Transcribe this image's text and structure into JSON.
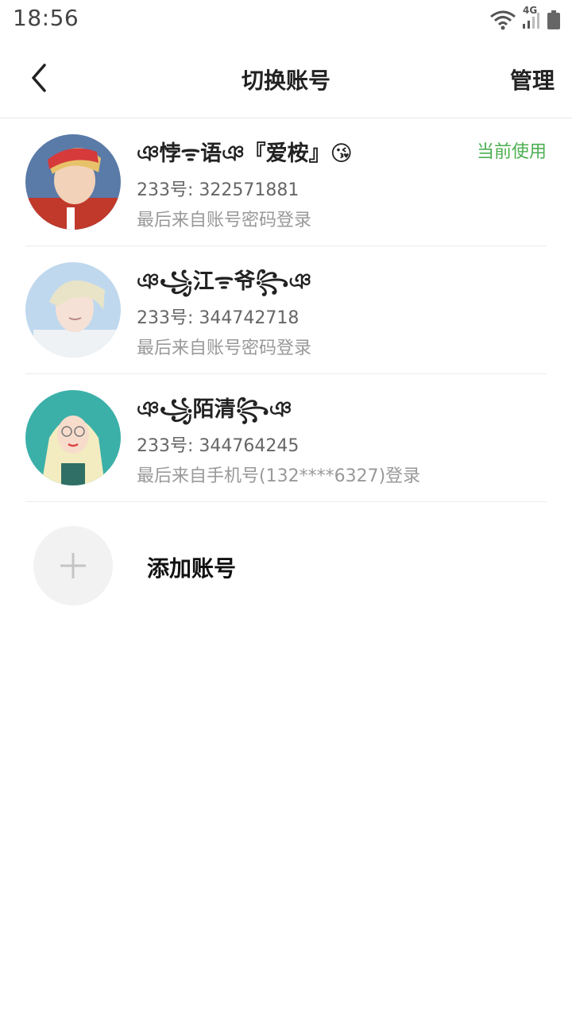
{
  "status_bar": {
    "time": "18:56",
    "network": "4G"
  },
  "header": {
    "title": "切换账号",
    "manage_label": "管理"
  },
  "accounts": [
    {
      "name": "ঞ悖ᯤ语ঞ『爱桉』😘",
      "id_text": "233号: 322571881",
      "login_text": "最后来自账号密码登录",
      "tag": "当前使用"
    },
    {
      "name": "ঞ꧁江ᯤ爷꧂ঞ",
      "id_text": "233号: 344742718",
      "login_text": "最后来自账号密码登录"
    },
    {
      "name": "ঞ꧁陌清꧂ঞ",
      "id_text": "233号: 344764245",
      "login_text": "最后来自手机号(132****6327)登录"
    }
  ],
  "add_account": {
    "label": "添加账号"
  },
  "colors": {
    "accent_green": "#4caf50",
    "secondary_text": "#999999"
  }
}
